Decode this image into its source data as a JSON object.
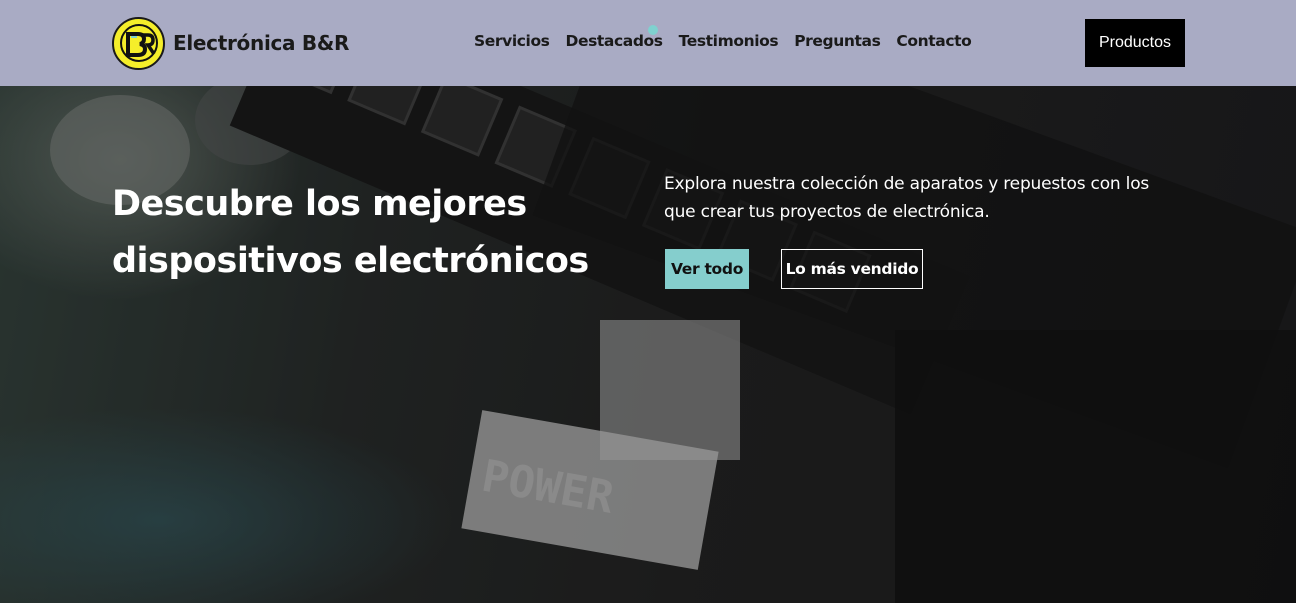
{
  "brand": {
    "name": "Electrónica B&R",
    "logo_icon": "br-monogram-icon"
  },
  "nav": {
    "items": [
      "Servicios",
      "Destacados",
      "Testimonios",
      "Preguntas",
      "Contacto"
    ],
    "cta_label": "Productos"
  },
  "hero": {
    "headline_line1": "Descubre los mejores",
    "headline_line2": "dispositivos electrónicos",
    "description_line1": "Explora nuestra colección de aparatos y repuestos con los",
    "description_line2": "que crear tus proyectos de electrónica.",
    "primary_label": "Ver todo",
    "secondary_label": "Lo más vendido"
  },
  "colors": {
    "nav_bg": "#a9abc4",
    "accent": "#85cecd",
    "logo_yellow": "#f5ee2a"
  }
}
